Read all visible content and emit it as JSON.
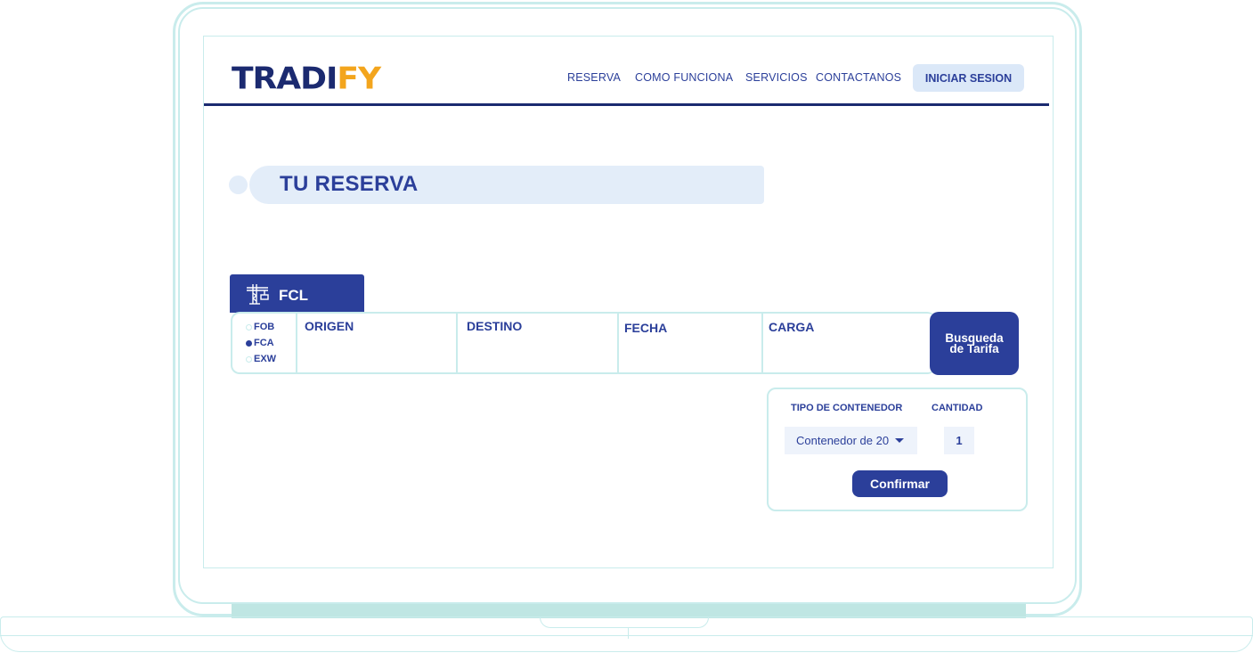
{
  "brand": {
    "logo_part1": "TRADI",
    "logo_part2": "FY"
  },
  "nav": {
    "items": [
      {
        "label": "RESERVA"
      },
      {
        "label": "COMO FUNCIONA"
      },
      {
        "label": "SERVICIOS"
      },
      {
        "label": "CONTACTANOS"
      }
    ],
    "login_label": "INICIAR SESION"
  },
  "page": {
    "title": "TU RESERVA"
  },
  "booking": {
    "mode_tab": {
      "label": "FCL",
      "icon": "crane-icon"
    },
    "incoterms": [
      {
        "label": "FOB",
        "selected": false
      },
      {
        "label": "FCA",
        "selected": true
      },
      {
        "label": "EXW",
        "selected": false
      }
    ],
    "fields": {
      "origin": "ORIGEN",
      "destination": "DESTINO",
      "date": "FECHA",
      "cargo": "CARGA"
    },
    "search_button": "Busqueda de Tarifa"
  },
  "container_panel": {
    "type_header": "TIPO DE CONTENEDOR",
    "quantity_header": "CANTIDAD",
    "type_value": "Contenedor de 20",
    "quantity_value": "1",
    "confirm_label": "Confirmar"
  },
  "colors": {
    "primary": "#2b3f9a",
    "navy": "#1b2a70",
    "accent": "#f3a51d",
    "frame": "#c9ecec",
    "light_fill": "#e3edf9"
  }
}
